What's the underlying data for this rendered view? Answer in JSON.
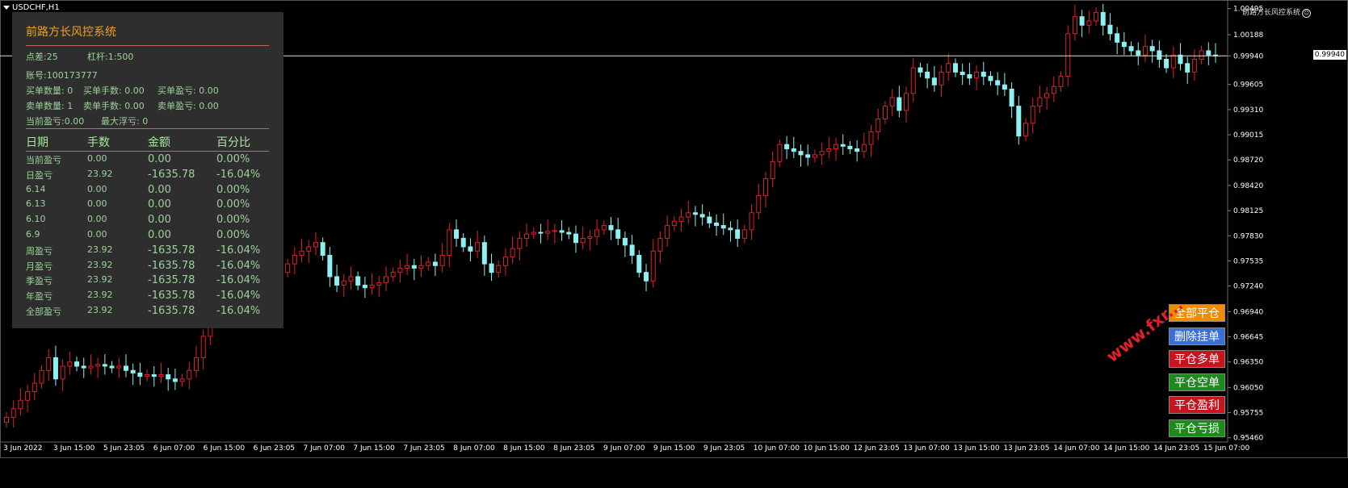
{
  "symbol": "USDCHF,H1",
  "ea_label": "前路方长风控系统",
  "current_price": "0.99940",
  "panel": {
    "title": "前路方长风控系统",
    "spread": "点差:25",
    "leverage": "杠杆:1:500",
    "account": "账号:100173777",
    "buy_count": "买单数量: 0",
    "buy_lots": "买单手数: 0.00",
    "buy_profit": "买单盈亏: 0.00",
    "sell_count": "卖单数量: 1",
    "sell_lots": "卖单手数: 0.00",
    "sell_profit": "卖单盈亏: 0.00",
    "current_pl": "当前盈亏:0.00",
    "max_float": "最大浮亏: 0",
    "headers": [
      "日期",
      "手数",
      "金额",
      "百分比"
    ],
    "rows": [
      [
        "当前盈亏",
        "0.00",
        "0.00",
        "0.00%"
      ],
      [
        "日盈亏",
        "23.92",
        "-1635.78",
        "-16.04%"
      ],
      [
        "6.14",
        "0.00",
        "0.00",
        "0.00%"
      ],
      [
        "6.13",
        "0.00",
        "0.00",
        "0.00%"
      ],
      [
        "6.10",
        "0.00",
        "0.00",
        "0.00%"
      ],
      [
        "6.9",
        "0.00",
        "0.00",
        "0.00%"
      ],
      [
        "周盈亏",
        "23.92",
        "-1635.78",
        "-16.04%"
      ],
      [
        "月盈亏",
        "23.92",
        "-1635.78",
        "-16.04%"
      ],
      [
        "季盈亏",
        "23.92",
        "-1635.78",
        "-16.04%"
      ],
      [
        "年盈亏",
        "23.92",
        "-1635.78",
        "-16.04%"
      ],
      [
        "全部盈亏",
        "23.92",
        "-1635.78",
        "-16.04%"
      ]
    ]
  },
  "buttons": [
    {
      "label": "全部平仓",
      "color": "#f08c00"
    },
    {
      "label": "删除挂单",
      "color": "#3b6fd8"
    },
    {
      "label": "平仓多单",
      "color": "#c8141e"
    },
    {
      "label": "平仓空单",
      "color": "#1e8a1e"
    },
    {
      "label": "平仓盈利",
      "color": "#c8141e"
    },
    {
      "label": "平仓亏损",
      "color": "#1e8a1e"
    }
  ],
  "watermark": "www.fxr...",
  "colors": {
    "bull": "#e0202a",
    "bear": "#8ef0f0",
    "price_line": "#e8e8a0",
    "axis_text": "#ffffff"
  },
  "chart_data": {
    "type": "candlestick",
    "y_ticks": [
      "1.00495",
      "1.00188",
      "0.99940",
      "0.99605",
      "0.99310",
      "0.99015",
      "0.98720",
      "0.98420",
      "0.98125",
      "0.97830",
      "0.97535",
      "0.97240",
      "0.96940",
      "0.96645",
      "0.96350",
      "0.96050",
      "0.95755",
      "0.95460"
    ],
    "x_ticks": [
      "3 Jun 2022",
      "3 Jun 15:00",
      "5 Jun 23:05",
      "6 Jun 07:00",
      "6 Jun 15:00",
      "6 Jun 23:05",
      "7 Jun 07:00",
      "7 Jun 15:00",
      "7 Jun 23:05",
      "8 Jun 07:00",
      "8 Jun 15:00",
      "8 Jun 23:05",
      "9 Jun 07:00",
      "9 Jun 15:00",
      "9 Jun 23:05",
      "10 Jun 07:00",
      "10 Jun 15:00",
      "12 Jun 23:05",
      "13 Jun 07:00",
      "13 Jun 15:00",
      "13 Jun 23:05",
      "14 Jun 07:00",
      "14 Jun 15:00",
      "14 Jun 23:05",
      "15 Jun 07:00"
    ],
    "ylim": [
      0.9541,
      1.0052
    ],
    "closes": [
      0.957,
      0.958,
      0.959,
      0.96,
      0.961,
      0.9625,
      0.964,
      0.9615,
      0.963,
      0.9635,
      0.963,
      0.9628,
      0.963,
      0.9632,
      0.963,
      0.9628,
      0.963,
      0.9625,
      0.9622,
      0.9618,
      0.962,
      0.9618,
      0.962,
      0.9615,
      0.9612,
      0.9615,
      0.9625,
      0.964,
      0.9665,
      0.969,
      0.972,
      0.974,
      0.976,
      0.977,
      0.9765,
      0.9745,
      0.973,
      0.9735,
      0.9725,
      0.974,
      0.975,
      0.976,
      0.9765,
      0.977,
      0.9775,
      0.976,
      0.9735,
      0.9725,
      0.973,
      0.9735,
      0.9725,
      0.9722,
      0.9725,
      0.9728,
      0.9735,
      0.974,
      0.9745,
      0.9748,
      0.9745,
      0.9748,
      0.9752,
      0.9748,
      0.976,
      0.979,
      0.978,
      0.977,
      0.9765,
      0.9775,
      0.975,
      0.974,
      0.9748,
      0.9758,
      0.9768,
      0.978,
      0.9785,
      0.9787,
      0.9786,
      0.9788,
      0.9789,
      0.9787,
      0.9785,
      0.9775,
      0.978,
      0.9782,
      0.979,
      0.9795,
      0.979,
      0.978,
      0.9772,
      0.976,
      0.974,
      0.973,
      0.9765,
      0.978,
      0.9795,
      0.98,
      0.9805,
      0.981,
      0.9808,
      0.9805,
      0.9798,
      0.9795,
      0.9792,
      0.979,
      0.978,
      0.979,
      0.981,
      0.983,
      0.985,
      0.987,
      0.989,
      0.9885,
      0.9882,
      0.9878,
      0.9875,
      0.9878,
      0.9882,
      0.9885,
      0.989,
      0.9888,
      0.9885,
      0.9882,
      0.989,
      0.9905,
      0.992,
      0.9935,
      0.9945,
      0.993,
      0.995,
      0.998,
      0.9975,
      0.9968,
      0.996,
      0.9975,
      0.9985,
      0.9975,
      0.9972,
      0.9968,
      0.9975,
      0.997,
      0.9965,
      0.996,
      0.9955,
      0.9935,
      0.99,
      0.9915,
      0.9935,
      0.9945,
      0.995,
      0.9958,
      0.997,
      1.002,
      1.004,
      1.003,
      1.0035,
      1.0045,
      1.003,
      1.002,
      1.001,
      1.0005,
      1.0,
      0.9995,
      1.0005,
      1.0,
      0.999,
      0.998,
      0.9995,
      0.9985,
      0.9975,
      0.999,
      1.0,
      0.9995,
      0.9994
    ]
  }
}
